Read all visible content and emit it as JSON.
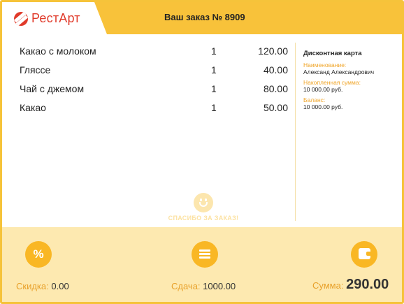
{
  "app": {
    "brand": "РестАрт",
    "order_title": "Ваш заказ № 8909"
  },
  "items": [
    {
      "name": "Какао с молоком",
      "qty": "1",
      "price": "120.00"
    },
    {
      "name": "Гляссе",
      "qty": "1",
      "price": "40.00"
    },
    {
      "name": "Чай с джемом",
      "qty": "1",
      "price": "80.00"
    },
    {
      "name": "Какао",
      "qty": "1",
      "price": "50.00"
    }
  ],
  "card": {
    "title": "Дисконтная карта",
    "name_label": "Наименование:",
    "name_value": "Александ Александрович",
    "accum_label": "Накопленная сумма:",
    "accum_value": "10 000.00 руб.",
    "balance_label": "Баланс:",
    "balance_value": "10 000.00 руб."
  },
  "thanks": "СПАСИБО ЗА ЗАКАЗ!",
  "footer": {
    "discount_icon_glyph": "%",
    "discount_label": "Скидка:",
    "discount_value": "0.00",
    "change_label": "Сдача:",
    "change_value": "1000.00",
    "total_label": "Сумма:",
    "total_value": "290.00"
  },
  "colors": {
    "accent": "#f8c23a",
    "brand_red": "#e03a2a",
    "background": "#fde9b0"
  }
}
